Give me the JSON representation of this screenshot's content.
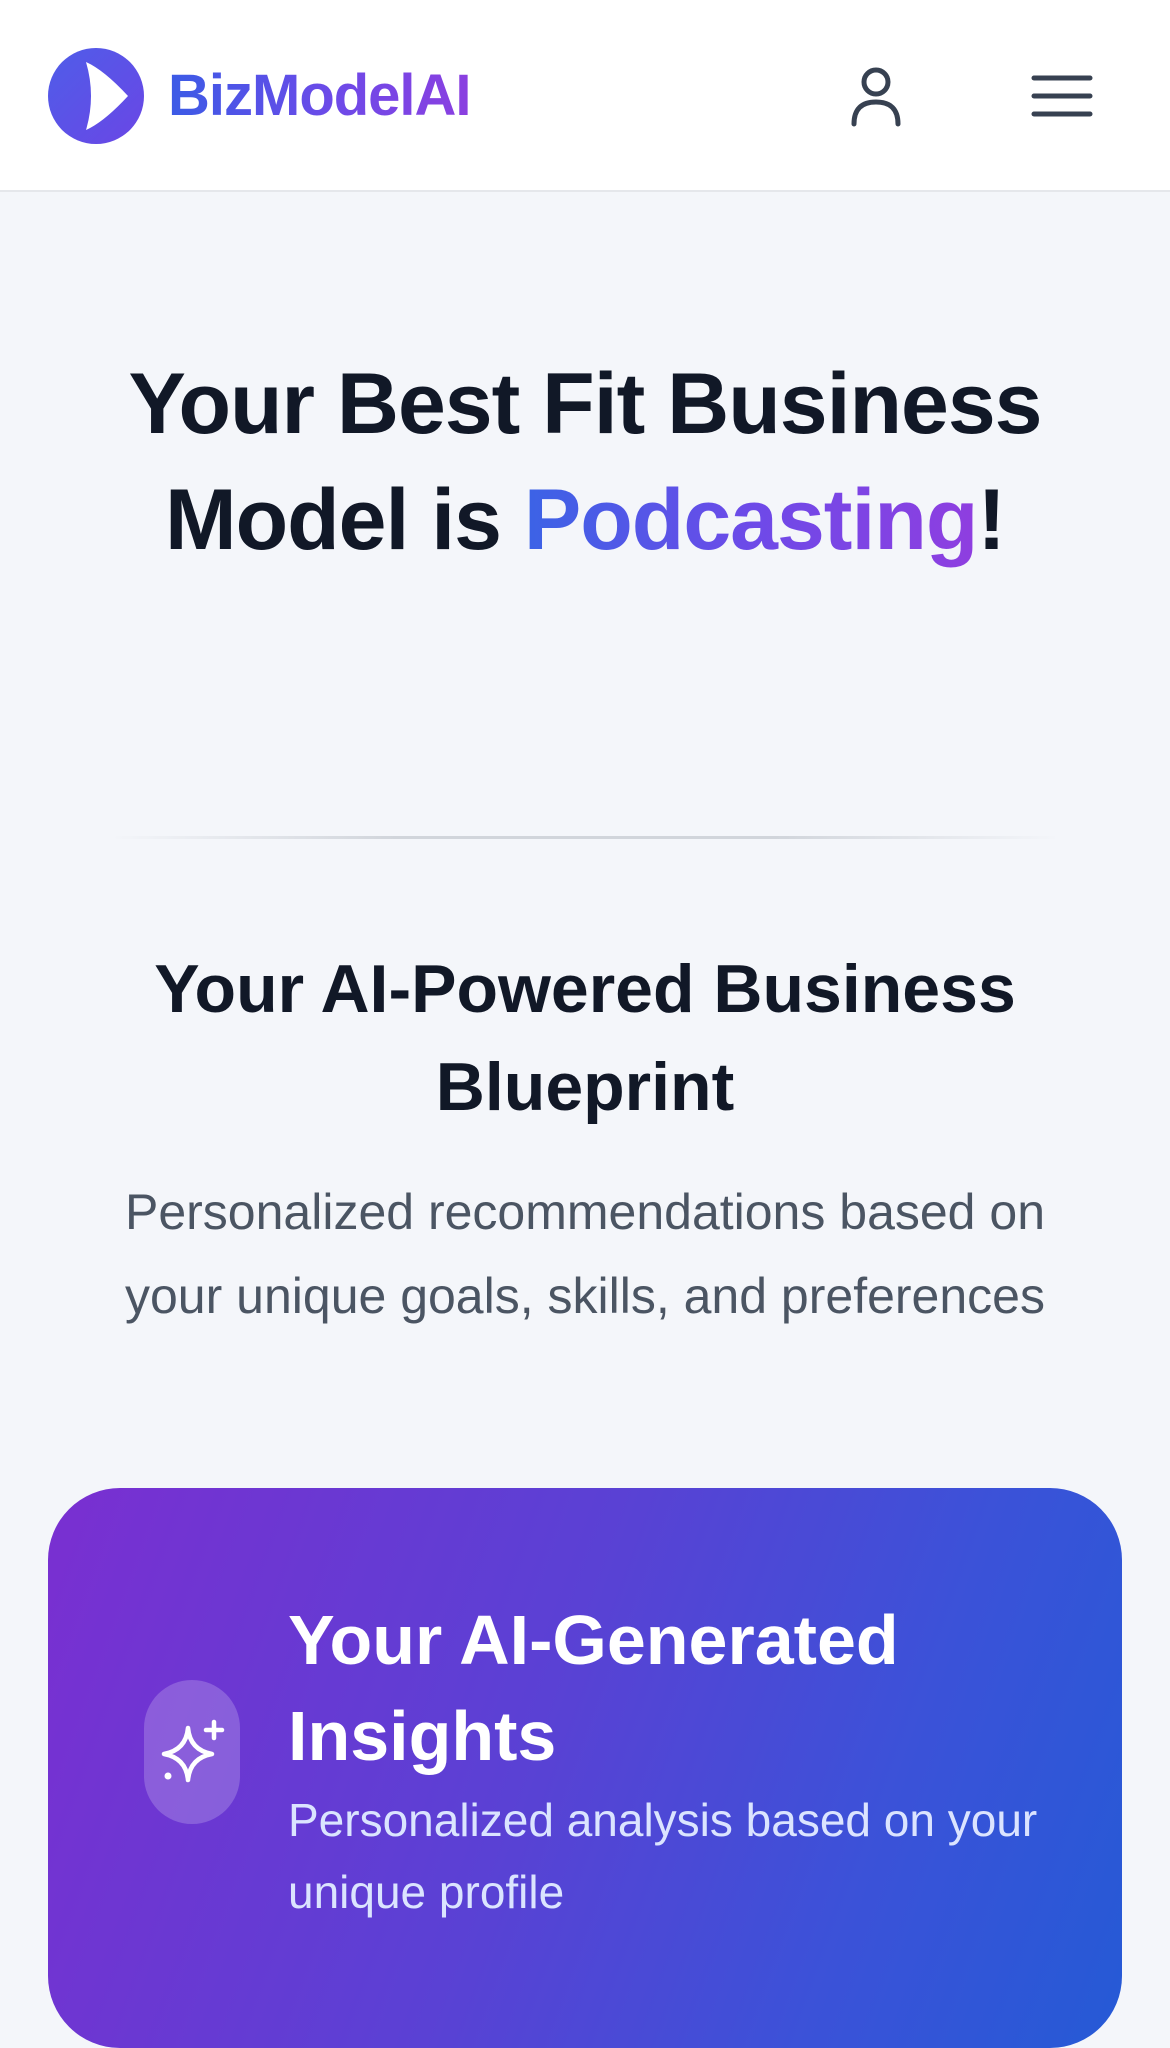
{
  "header": {
    "brand": "BizModelAI",
    "icons": {
      "logo": "play-logo-icon",
      "user": "user-icon",
      "menu": "hamburger-menu-icon"
    }
  },
  "hero": {
    "title_prefix": "Your Best Fit Business Model is ",
    "title_highlight": "Podcasting",
    "title_suffix": "!"
  },
  "blueprint": {
    "title": "Your AI-Powered Business Blueprint",
    "subtitle": "Personalized recommendations based on your unique goals, skills, and preferences"
  },
  "insights_card": {
    "icon": "sparkles-icon",
    "title": "Your AI-Generated Insights",
    "subtitle": "Personalized analysis based on your unique profile"
  },
  "colors": {
    "brand_blue": "#3b5be6",
    "brand_purple": "#8b3fe0",
    "text_dark": "#111827",
    "text_muted": "#4b5563",
    "page_bg": "#f4f6fa"
  }
}
